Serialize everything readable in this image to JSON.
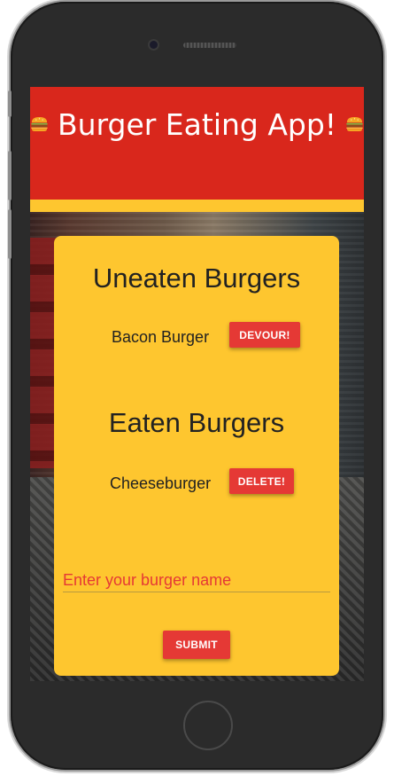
{
  "header": {
    "title": "Burger Eating App!",
    "left_icon": "burger-icon",
    "right_icon": "burger-icon",
    "background_color": "#d9271c",
    "stripe_color": "#fec62f"
  },
  "uneaten": {
    "title": "Uneaten Burgers",
    "items": [
      {
        "name": "Bacon Burger",
        "button_label": "DEVOUR!"
      }
    ]
  },
  "eaten": {
    "title": "Eaten Burgers",
    "items": [
      {
        "name": "Cheeseburger",
        "button_label": "DELETE!"
      }
    ]
  },
  "form": {
    "placeholder": "Enter your burger name",
    "value": "",
    "submit_label": "SUBMIT"
  },
  "colors": {
    "card": "#fec62f",
    "button": "#e53935",
    "input_text": "#e53935"
  }
}
